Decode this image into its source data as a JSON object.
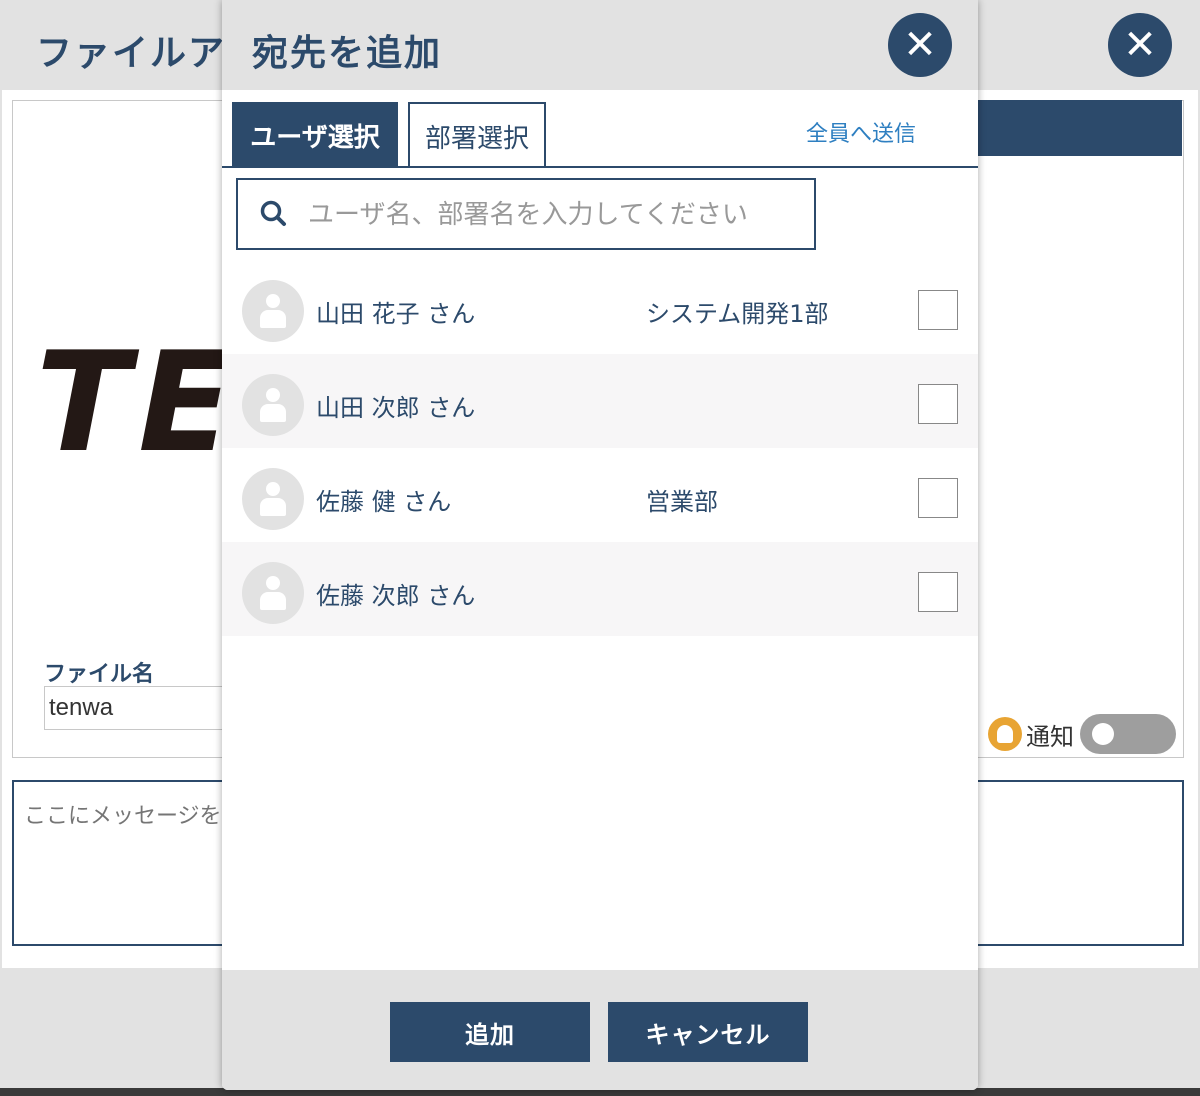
{
  "background_dialog": {
    "title": "ファイルア",
    "close_label": "✕",
    "logo_text": "TE",
    "filename_label": "ファイル名",
    "filename_value": "tenwa",
    "notify_label": "通知",
    "message_placeholder": "ここにメッセージを"
  },
  "modal": {
    "title": "宛先を追加",
    "close_label": "✕",
    "tabs": [
      {
        "label": "ユーザ選択",
        "active": true
      },
      {
        "label": "部署選択",
        "active": false
      }
    ],
    "send_all_label": "全員へ送信",
    "search": {
      "placeholder": "ユーザ名、部署名を入力してください"
    },
    "users": [
      {
        "name": "山田 花子 さん",
        "dept": "システム開発1部",
        "checked": false
      },
      {
        "name": "山田 次郎 さん",
        "dept": "",
        "checked": false
      },
      {
        "name": "佐藤 健 さん",
        "dept": "営業部",
        "checked": false
      },
      {
        "name": "佐藤 次郎 さん",
        "dept": "",
        "checked": false
      }
    ],
    "footer": {
      "add_label": "追加",
      "cancel_label": "キャンセル"
    }
  },
  "colors": {
    "navy": "#2c4a6b",
    "link": "#2e7fc1",
    "bell": "#e8a433"
  }
}
